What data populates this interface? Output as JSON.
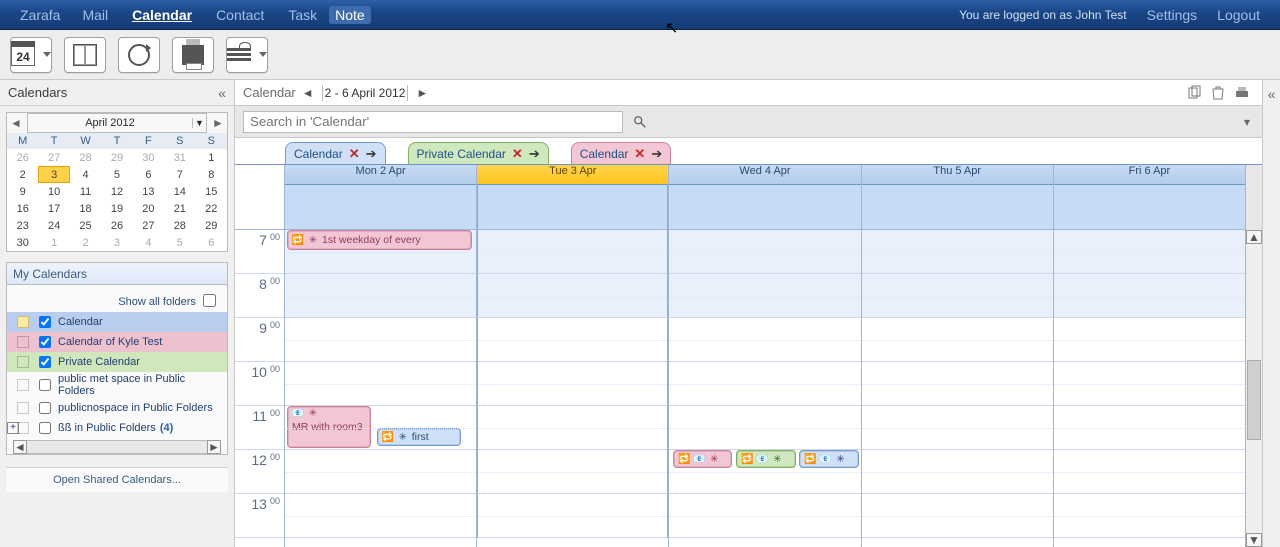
{
  "nav": {
    "brand": "Zarafa",
    "items": [
      "Mail",
      "Calendar",
      "Contact",
      "Task",
      "Note"
    ],
    "active": "Calendar",
    "loggedText": "You are logged on as John Test",
    "settings": "Settings",
    "logout": "Logout"
  },
  "toolbar": {
    "newAppointment": "New Appointment",
    "addressBook": "Address Book",
    "refresh": "Refresh",
    "print": "Print",
    "view": "View"
  },
  "sidebar": {
    "header": "Calendars",
    "datepicker": {
      "month": "April 2012",
      "dow": [
        "M",
        "T",
        "W",
        "T",
        "F",
        "S",
        "S"
      ],
      "weeks": [
        [
          "26",
          "27",
          "28",
          "29",
          "30",
          "31",
          "1"
        ],
        [
          "2",
          "3",
          "4",
          "5",
          "6",
          "7",
          "8"
        ],
        [
          "9",
          "10",
          "11",
          "12",
          "13",
          "14",
          "15"
        ],
        [
          "16",
          "17",
          "18",
          "19",
          "20",
          "21",
          "22"
        ],
        [
          "23",
          "24",
          "25",
          "26",
          "27",
          "28",
          "29"
        ],
        [
          "30",
          "1",
          "2",
          "3",
          "4",
          "5",
          "6"
        ]
      ],
      "today": "3"
    },
    "myCalendarsTitle": "My Calendars",
    "showAll": "Show all folders",
    "calendars": [
      {
        "label": "Calendar",
        "color": "blue",
        "checked": true
      },
      {
        "label": "Calendar of Kyle Test",
        "color": "pink",
        "checked": true
      },
      {
        "label": "Private Calendar",
        "color": "green",
        "checked": true
      },
      {
        "label": "public met space in Public Folders",
        "color": "plain",
        "checked": false
      },
      {
        "label": "publicnospace in Public Folders",
        "color": "plain",
        "checked": false
      },
      {
        "label": "ßß in Public Folders",
        "color": "plain",
        "checked": false,
        "count": "(4)",
        "expandable": true
      }
    ],
    "openShared": "Open Shared Calendars..."
  },
  "main": {
    "breadcrumb": {
      "label": "Calendar",
      "range": "2 - 6 April 2012"
    },
    "searchPlaceholder": "Search in 'Calendar'",
    "tabs": [
      {
        "label": "Calendar",
        "color": "blue"
      },
      {
        "label": "Private Calendar",
        "color": "green"
      },
      {
        "label": "Calendar",
        "color": "pink"
      }
    ],
    "days": [
      "Mon 2 Apr",
      "Tue 3 Apr",
      "Wed 4 Apr",
      "Thu 5 Apr",
      "Fri 6 Apr"
    ],
    "todayIndex": 1,
    "hours": [
      "7",
      "8",
      "9",
      "10",
      "11",
      "12",
      "13"
    ],
    "events": {
      "mon7": "1st weekday of every",
      "mon11a": "MR with room3",
      "mon11b": "first"
    }
  }
}
